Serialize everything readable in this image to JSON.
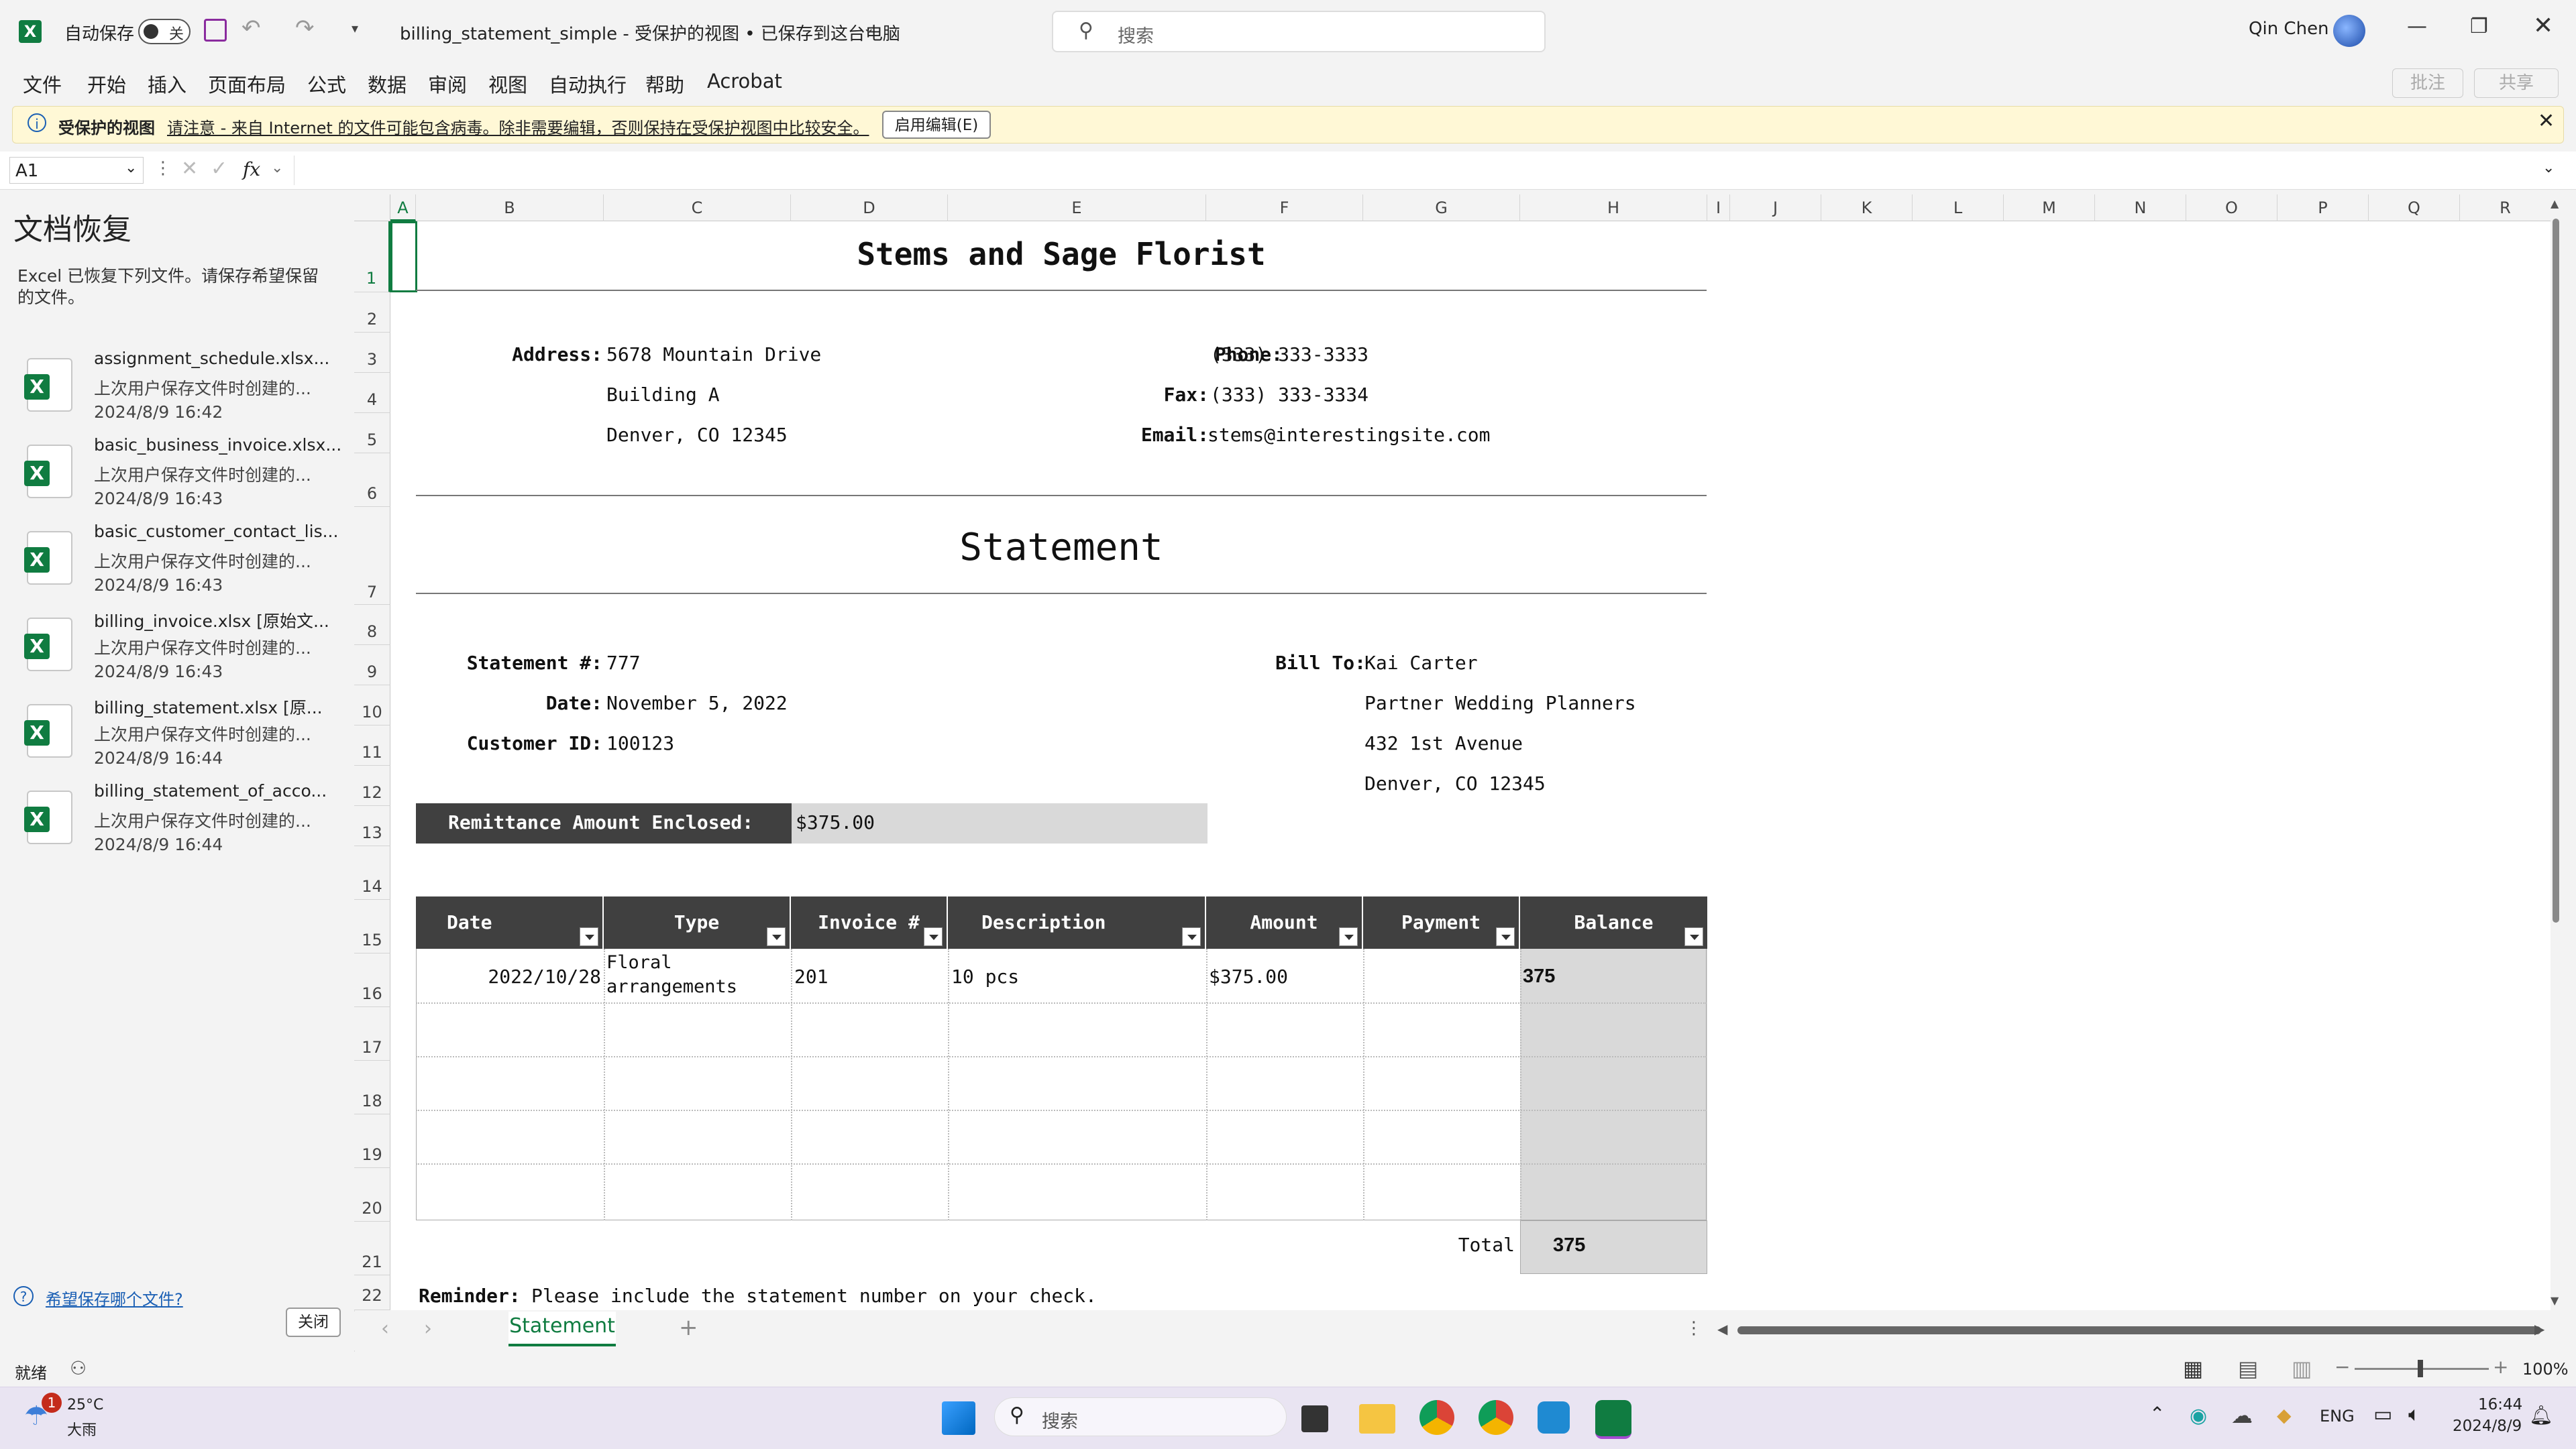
{
  "titlebar": {
    "autosave_label": "自动保存",
    "autosave_state": "关",
    "doc_title": "billing_statement_simple  -  受保护的视图 • 已保存到这台电脑",
    "search_placeholder": "搜索",
    "user_name": "Qin Chen"
  },
  "menu": [
    "文件",
    "开始",
    "插入",
    "页面布局",
    "公式",
    "数据",
    "审阅",
    "视图",
    "自动执行",
    "帮助",
    "Acrobat"
  ],
  "menu_right": {
    "comments": "批注",
    "share": "共享"
  },
  "protected_bar": {
    "title": "受保护的视图",
    "message": "请注意 - 来自 Internet 的文件可能包含病毒。除非需要编辑，否则保持在受保护视图中比较安全。",
    "button": "启用编辑(E)"
  },
  "formula_bar": {
    "name_box": "A1",
    "fx": "fx",
    "value": ""
  },
  "recovery": {
    "title": "文档恢复",
    "intro": "Excel 已恢复下列文件。请保存希望保留的文件。",
    "files": [
      {
        "name": "assignment_schedule.xlsx...",
        "desc": "上次用户保存文件时创建的...",
        "time": "2024/8/9 16:42"
      },
      {
        "name": "basic_business_invoice.xlsx...",
        "desc": "上次用户保存文件时创建的...",
        "time": "2024/8/9 16:43"
      },
      {
        "name": "basic_customer_contact_lis...",
        "desc": "上次用户保存文件时创建的...",
        "time": "2024/8/9 16:43"
      },
      {
        "name": "billing_invoice.xlsx  [原始文...",
        "desc": "上次用户保存文件时创建的...",
        "time": "2024/8/9 16:43"
      },
      {
        "name": "billing_statement.xlsx  [原...",
        "desc": "上次用户保存文件时创建的...",
        "time": "2024/8/9 16:44"
      },
      {
        "name": "billing_statement_of_acco...",
        "desc": "上次用户保存文件时创建的...",
        "time": "2024/8/9 16:44"
      }
    ],
    "help_link": "希望保存哪个文件?",
    "close_button": "关闭"
  },
  "grid": {
    "columns": [
      "A",
      "B",
      "C",
      "D",
      "E",
      "F",
      "G",
      "H",
      "I",
      "J",
      "K",
      "L",
      "M",
      "N",
      "O",
      "P",
      "Q",
      "R"
    ],
    "rows": [
      "1",
      "2",
      "3",
      "4",
      "5",
      "6",
      "7",
      "8",
      "9",
      "10",
      "11",
      "12",
      "13",
      "14",
      "15",
      "16",
      "17",
      "18",
      "19",
      "20",
      "21",
      "22"
    ]
  },
  "statement": {
    "company": "Stems and Sage Florist",
    "address_label": "Address:",
    "address_lines": [
      "5678 Mountain Drive",
      "Building A",
      "Denver, CO 12345"
    ],
    "phone_label": "Phone:",
    "phone": "(333) 333-3333",
    "fax_label": "Fax:",
    "fax": "(333) 333-3334",
    "email_label": "Email:",
    "email": "stems@interestingsite.com",
    "heading": "Statement",
    "statement_no_label": "Statement #:",
    "statement_no": "777",
    "date_label": "Date:",
    "date": "November 5, 2022",
    "customer_id_label": "Customer ID:",
    "customer_id": "100123",
    "bill_to_label": "Bill To:",
    "bill_to_lines": [
      "Kai Carter",
      "Partner Wedding Planners",
      "432 1st Avenue",
      "Denver, CO 12345"
    ],
    "remittance_label": "Remittance Amount Enclosed:",
    "remittance_value": "$375.00",
    "table_headers": [
      "Date",
      "Type",
      "Invoice #",
      "Description",
      "Amount",
      "Payment",
      "Balance"
    ],
    "row1": {
      "date": "2022/10/28",
      "type_line1": "Floral",
      "type_line2": "arrangements",
      "invoice": "201",
      "description": "10 pcs",
      "amount": "$375.00",
      "payment": "",
      "balance": "375"
    },
    "total_label": "Total",
    "total_value": "375",
    "reminder_label": "Reminder:",
    "reminder_text": "Please include the statement number on your check."
  },
  "sheet_tab": "Statement",
  "status": {
    "ready": "就绪",
    "zoom": "100%"
  },
  "taskbar": {
    "temp": "25°C",
    "weather": "大雨",
    "badge": "1",
    "search": "搜索",
    "lang": "ENG",
    "time": "16:44",
    "date": "2024/8/9"
  }
}
